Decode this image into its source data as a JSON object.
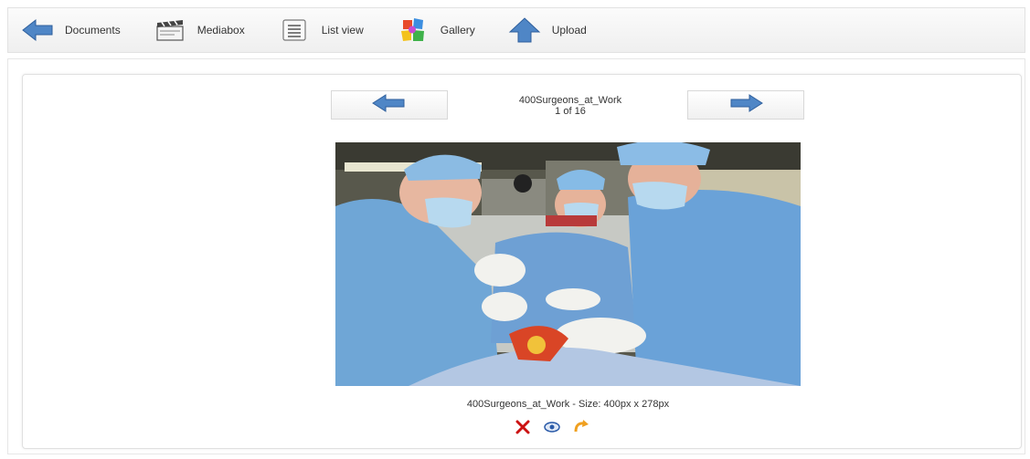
{
  "toolbar": {
    "items": [
      {
        "label": "Documents",
        "icon": "back-arrow-icon"
      },
      {
        "label": "Mediabox",
        "icon": "clapperboard-icon"
      },
      {
        "label": "List view",
        "icon": "list-icon"
      },
      {
        "label": "Gallery",
        "icon": "gallery-puzzle-icon"
      },
      {
        "label": "Upload",
        "icon": "upload-arrow-icon"
      }
    ]
  },
  "viewer": {
    "title": "400Surgeons_at_Work",
    "position": "1 of 16",
    "caption": "400Surgeons_at_Work - Size: 400px x 278px",
    "photo_description": "surgeons-at-work-photo"
  },
  "actions": [
    {
      "icon": "delete-x-icon",
      "color": "#cc1111"
    },
    {
      "icon": "view-eye-icon",
      "color": "#2a5aa8"
    },
    {
      "icon": "rotate-arrow-icon",
      "color": "#f0a020"
    }
  ],
  "colors": {
    "arrow_blue": "#4f86c6",
    "toolbar_bg": "#f3f3f3"
  }
}
